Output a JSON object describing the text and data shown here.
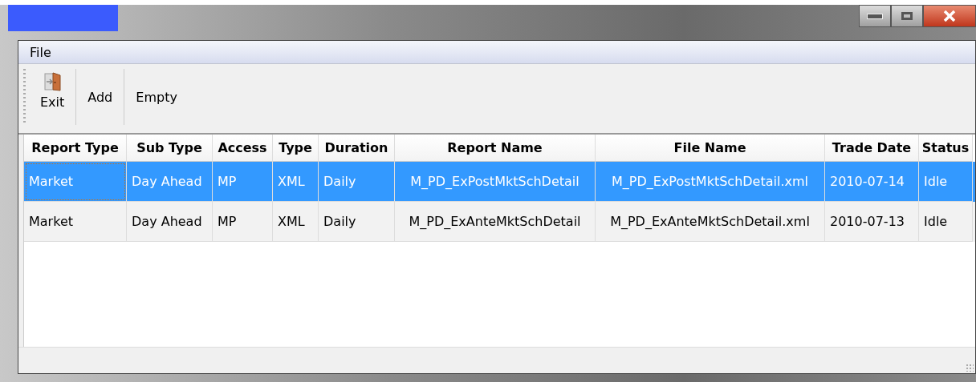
{
  "menu": [
    "File"
  ],
  "toolbar": [
    {
      "kind": "icon",
      "label": "Exit"
    },
    {
      "kind": "text",
      "label": "Add"
    },
    {
      "kind": "text",
      "label": "Empty"
    }
  ],
  "table": {
    "columns": [
      "Report Type",
      "Sub Type",
      "Access",
      "Type",
      "Duration",
      "Report Name",
      "File Name",
      "Trade Date",
      "Status"
    ],
    "rows": [
      {
        "selected": true,
        "cells": [
          "Market",
          "Day Ahead",
          "MP",
          "XML",
          "Daily",
          "M_PD_ExPostMktSchDetail",
          "M_PD_ExPostMktSchDetail.xml",
          "2010-07-14",
          "Idle"
        ]
      },
      {
        "selected": false,
        "cells": [
          "Market",
          "Day Ahead",
          "MP",
          "XML",
          "Daily",
          "M_PD_ExAnteMktSchDetail",
          "M_PD_ExAnteMktSchDetail.xml",
          "2010-07-13",
          "Idle"
        ]
      }
    ]
  }
}
